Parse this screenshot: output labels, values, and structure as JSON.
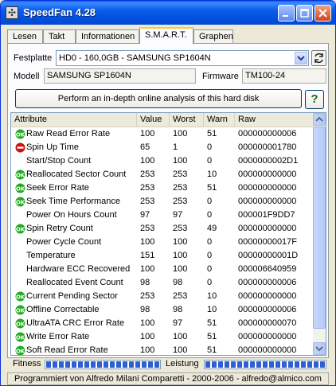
{
  "window": {
    "title": "SpeedFan 4.28"
  },
  "tabs": [
    {
      "label": "Lesen"
    },
    {
      "label": "Takt"
    },
    {
      "label": "Informationen"
    },
    {
      "label": "S.M.A.R.T."
    },
    {
      "label": "Graphen"
    }
  ],
  "active_tab": "S.M.A.R.T.",
  "smart": {
    "disk_label": "Festplatte",
    "disk_selected": "HD0 - 160,0GB - SAMSUNG SP1604N",
    "model_label": "Modell",
    "model_value": "SAMSUNG SP1604N",
    "firmware_label": "Firmware",
    "firmware_value": "TM100-24",
    "analysis_button": "Perform an in-depth online analysis of this hard disk",
    "help_button": "?",
    "columns": [
      "Attribute",
      "Value",
      "Worst",
      "Warn",
      "Raw"
    ],
    "rows": [
      {
        "status": "ok",
        "attribute": "Raw Read Error Rate",
        "value": "100",
        "worst": "100",
        "warn": "51",
        "raw": "000000000006"
      },
      {
        "status": "bad",
        "attribute": "Spin Up Time",
        "value": "65",
        "worst": "1",
        "warn": "0",
        "raw": "000000001780"
      },
      {
        "status": "none",
        "attribute": "Start/Stop Count",
        "value": "100",
        "worst": "100",
        "warn": "0",
        "raw": "0000000002D1"
      },
      {
        "status": "ok",
        "attribute": "Reallocated Sector Count",
        "value": "253",
        "worst": "253",
        "warn": "10",
        "raw": "000000000000"
      },
      {
        "status": "ok",
        "attribute": "Seek Error Rate",
        "value": "253",
        "worst": "253",
        "warn": "51",
        "raw": "000000000000"
      },
      {
        "status": "ok",
        "attribute": "Seek Time Performance",
        "value": "253",
        "worst": "253",
        "warn": "0",
        "raw": "000000000000"
      },
      {
        "status": "none",
        "attribute": "Power On Hours Count",
        "value": "97",
        "worst": "97",
        "warn": "0",
        "raw": "000001F9DD7"
      },
      {
        "status": "ok",
        "attribute": "Spin Retry Count",
        "value": "253",
        "worst": "253",
        "warn": "49",
        "raw": "000000000000"
      },
      {
        "status": "none",
        "attribute": "Power Cycle Count",
        "value": "100",
        "worst": "100",
        "warn": "0",
        "raw": "00000000017F"
      },
      {
        "status": "none",
        "attribute": "Temperature",
        "value": "151",
        "worst": "100",
        "warn": "0",
        "raw": "00000000001D"
      },
      {
        "status": "none",
        "attribute": "Hardware ECC Recovered",
        "value": "100",
        "worst": "100",
        "warn": "0",
        "raw": "000006640959"
      },
      {
        "status": "none",
        "attribute": "Reallocated Event Count",
        "value": "98",
        "worst": "98",
        "warn": "0",
        "raw": "000000000006"
      },
      {
        "status": "ok",
        "attribute": "Current Pending Sector",
        "value": "253",
        "worst": "253",
        "warn": "10",
        "raw": "000000000000"
      },
      {
        "status": "ok",
        "attribute": "Offline Correctable",
        "value": "98",
        "worst": "98",
        "warn": "10",
        "raw": "000000000006"
      },
      {
        "status": "ok",
        "attribute": "UltraATA CRC Error Rate",
        "value": "100",
        "worst": "97",
        "warn": "51",
        "raw": "000000000070"
      },
      {
        "status": "ok",
        "attribute": "Write Error Rate",
        "value": "100",
        "worst": "100",
        "warn": "51",
        "raw": "000000000000"
      },
      {
        "status": "ok",
        "attribute": "Soft Read Error Rate",
        "value": "100",
        "worst": "100",
        "warn": "51",
        "raw": "000000000000"
      }
    ],
    "fitness_label": "Fitness",
    "fitness_level": 1.0,
    "performance_label": "Leistung",
    "performance_level": 1.0
  },
  "status_bar": "Programmiert von Alfredo Milani Comparetti - 2000-2006 - alfredo@almico.com",
  "colors": {
    "ok": "#22aa22",
    "bad": "#cc1111",
    "accent": "#0054e3"
  }
}
